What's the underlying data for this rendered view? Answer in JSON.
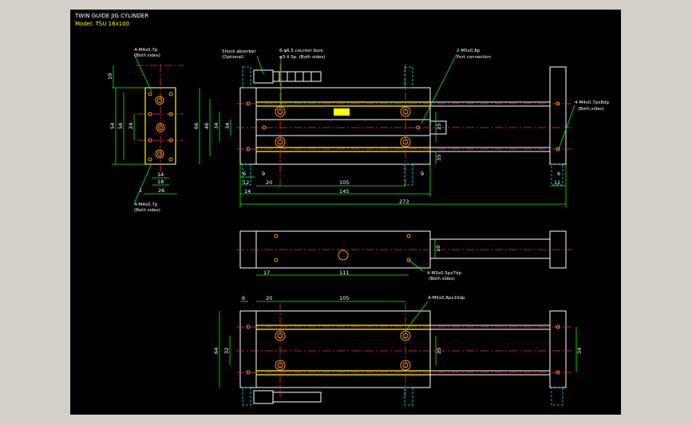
{
  "title": "TWIN GUIDE JIG CYLINDER",
  "model": "Model: TSU 16x100",
  "colors": {
    "background": "#000000",
    "outline": "#ffffff",
    "dimension": "#00ff00",
    "centerline": "#ff3030",
    "hidden": "#00e5ff",
    "rail": "#ffff00",
    "hole": "#ff9900"
  },
  "callouts": {
    "side_top": "4-M4x0.7p",
    "side_top_sub": "(Both sides)",
    "side_bottom": "4-M4x0.7p",
    "side_bottom_sub": "(Both sides)",
    "shock": "Shock absorber",
    "shock_sub": "(Optional)",
    "counterbore": "6-φ6.5 counter bore",
    "counterbore_sub": "φ3.4 Sp. (Both sides)",
    "port": "2-M5x0.8p",
    "port_sub": "Port connection",
    "right_end": "4-M4x0.7px8dp",
    "right_end_sub": "(Both sides)",
    "plan_holes": "4-M3x0.5px7dp",
    "plan_holes_sub": "(Both sides)",
    "bottom_holes": "4-M5x0.8px10dp"
  },
  "dimensions": {
    "side": [
      "10",
      "54",
      "56",
      "24",
      "14",
      "18",
      "26",
      "1"
    ],
    "front": [
      "66",
      "46",
      "34",
      "34",
      "25",
      "35",
      "6",
      "12",
      "9",
      "20",
      "105",
      "14",
      "145",
      "273",
      "9",
      "6",
      "12"
    ],
    "plan": [
      "10",
      "17",
      "111"
    ],
    "bottom": [
      "6",
      "20",
      "105",
      "64",
      "32",
      "25",
      "34"
    ]
  }
}
